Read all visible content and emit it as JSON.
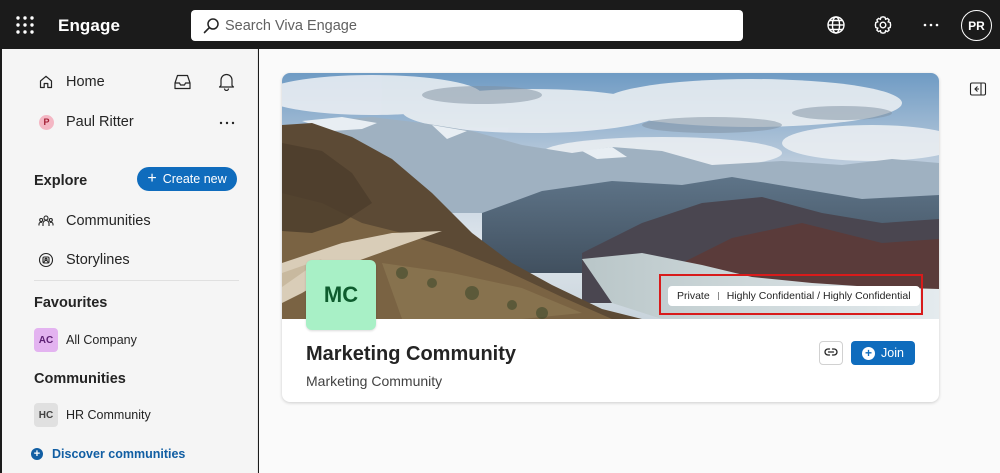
{
  "header": {
    "app_name": "Engage",
    "search_placeholder": "Search Viva Engage",
    "user_initials": "PR",
    "icons": [
      "waffle-icon",
      "globe-icon",
      "settings-icon",
      "more-icon"
    ]
  },
  "sidebar": {
    "home_label": "Home",
    "user": {
      "initial": "P",
      "name": "Paul Ritter"
    },
    "explore_heading": "Explore",
    "create_new_label": "Create new",
    "explore_items": [
      {
        "label": "Communities",
        "icon": "people-community-icon"
      },
      {
        "label": "Storylines",
        "icon": "storyline-icon"
      }
    ],
    "favourites_heading": "Favourites",
    "favourites": [
      {
        "initials": "AC",
        "name": "All Company",
        "color": "#e3b3f0",
        "text_color": "#5c1f73"
      }
    ],
    "communities_heading": "Communities",
    "communities": [
      {
        "initials": "HC",
        "name": "HR Community",
        "color": "#e0e0e0",
        "text_color": "#424242"
      }
    ],
    "discover_label": "Discover communities"
  },
  "community": {
    "avatar_initials": "MC",
    "avatar_color": "#a8f0c6",
    "privacy": "Private",
    "sensitivity": "Highly Confidential / Highly Confidential",
    "title": "Marketing Community",
    "description": "Marketing Community",
    "join_label": "Join"
  },
  "colors": {
    "accent": "#0f6cbd",
    "topbar": "#1b1b1b",
    "highlight": "#d81b1b"
  }
}
